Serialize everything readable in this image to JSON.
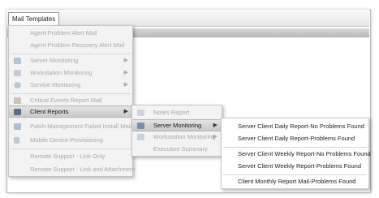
{
  "menubar": {
    "title": "Mail Templates"
  },
  "menu_main": {
    "items": [
      {
        "label": "Agent Problem Alert Mail",
        "icon": "none",
        "has_submenu": false,
        "disabled": true
      },
      {
        "label": "Agent Problem Recovery Alert Mail",
        "icon": "none",
        "has_submenu": false,
        "disabled": true
      },
      {
        "label": "Server Monitoring",
        "icon": "server-icon",
        "has_submenu": true,
        "disabled": true
      },
      {
        "label": "Workstation Monitoring",
        "icon": "workstation-icon",
        "has_submenu": true,
        "disabled": true
      },
      {
        "label": "Service Monitoring",
        "icon": "service-icon",
        "has_submenu": true,
        "disabled": true
      },
      {
        "label": "Critical Events Report Mail",
        "icon": "events-icon",
        "has_submenu": false,
        "disabled": true
      },
      {
        "label": "Client Reports",
        "icon": "client-reports-icon",
        "has_submenu": true,
        "disabled": false,
        "highlighted": true
      },
      {
        "label": "Patch Management Failed Install Mail",
        "icon": "patch-icon",
        "has_submenu": false,
        "disabled": true
      },
      {
        "label": "Mobile Device Provisioning",
        "icon": "mobile-icon",
        "has_submenu": false,
        "disabled": true
      },
      {
        "label": "Remote Support - Link Only",
        "icon": "none",
        "has_submenu": false,
        "disabled": true
      },
      {
        "label": "Remote Support - Link and Attachment",
        "icon": "none",
        "has_submenu": false,
        "disabled": true
      }
    ]
  },
  "menu_client_reports": {
    "items": [
      {
        "label": "Notes Report",
        "icon": "notes-icon",
        "has_submenu": false,
        "disabled": true
      },
      {
        "label": "Server Monitoring",
        "icon": "server-icon",
        "has_submenu": true,
        "disabled": false,
        "highlighted": true
      },
      {
        "label": "Workstation Monitoring",
        "icon": "workstation-icon",
        "has_submenu": true,
        "disabled": true
      },
      {
        "label": "Executive Summary",
        "icon": "none",
        "has_submenu": false,
        "disabled": true
      }
    ]
  },
  "menu_server_monitoring": {
    "items": [
      {
        "label": "Server Client Daily Report-No Problems Found"
      },
      {
        "label": "Server Client Daily Report-Problems Found"
      },
      {
        "label": "Server Client Weekly Report-No Problems Found"
      },
      {
        "label": "Server Client Weekly Report-Problems Found"
      },
      {
        "label": "Client Monthly Report Mail-Problems Found"
      }
    ]
  },
  "colors": {
    "highlight": "#c9c9c9",
    "disabled_text": "#a9a9a9",
    "icon_server": "#7d8fa8",
    "icon_client": "#5a6f8f"
  }
}
